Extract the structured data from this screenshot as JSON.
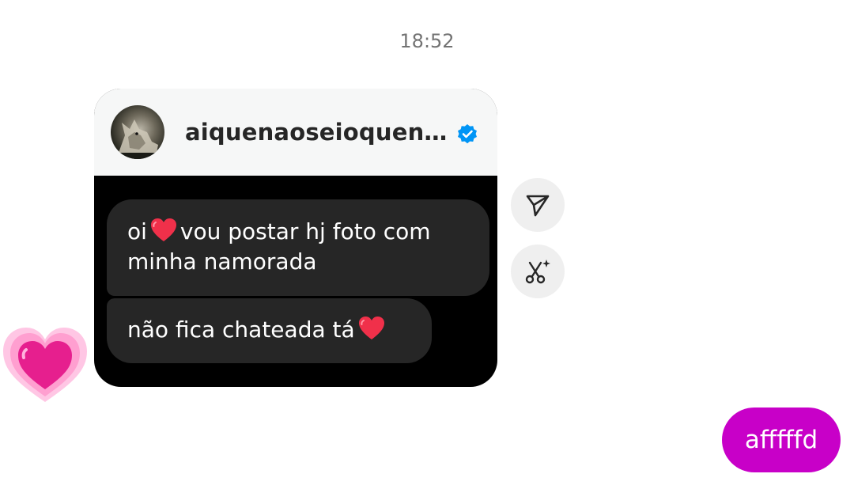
{
  "thread": {
    "timestamp": "18:52"
  },
  "shared_post": {
    "username": "aiquenaoseioquen…",
    "verified": true,
    "avatar_icon": "wolf-avatar",
    "messages": [
      {
        "line1_a": "oi",
        "line1_b": "vou postar hj foto com",
        "line2": "minha namorada"
      },
      {
        "line1_a": "não fica chateada tá"
      }
    ]
  },
  "actions": [
    {
      "icon": "send-icon"
    },
    {
      "icon": "scissors-sparkle-icon"
    }
  ],
  "reaction": {
    "icon": "pink-heart-emoji"
  },
  "my_message": {
    "text": "afffffd"
  },
  "colors": {
    "my_bubble": "#c800c8",
    "verified_badge": "#0095f6",
    "heart": "#f0304a",
    "card_header_bg": "#f6f7f7",
    "card_body_bg": "#000000",
    "dark_bubble": "#262626"
  }
}
